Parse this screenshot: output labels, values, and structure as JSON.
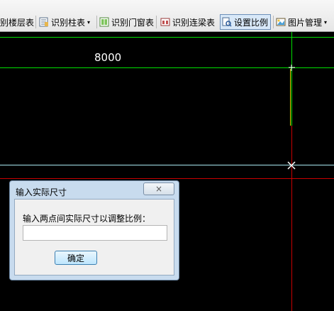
{
  "toolbar": {
    "items": [
      {
        "label": "别楼层表"
      },
      {
        "label": "识别柱表",
        "icon": "column-table-icon",
        "dropdown": "▾"
      },
      {
        "label": "识别门窗表",
        "icon": "door-window-table-icon"
      },
      {
        "label": "识别连梁表",
        "icon": "link-beam-table-icon"
      },
      {
        "label": "设置比例",
        "icon": "set-scale-icon",
        "active": true
      },
      {
        "label": "图片管理",
        "icon": "image-manage-icon",
        "dropdown": "▾"
      }
    ]
  },
  "canvas": {
    "dimension_text": "8000",
    "colors": {
      "green": "#00e000",
      "cyan": "#a8e8f0",
      "red": "#c80000",
      "yellow": "#d8d800",
      "background": "#000000"
    }
  },
  "dialog": {
    "title": "输入实际尺寸",
    "close_label": "×",
    "prompt": "输入两点间实际尺寸以调整比例：",
    "input_value": "",
    "ok_label": "确定"
  }
}
